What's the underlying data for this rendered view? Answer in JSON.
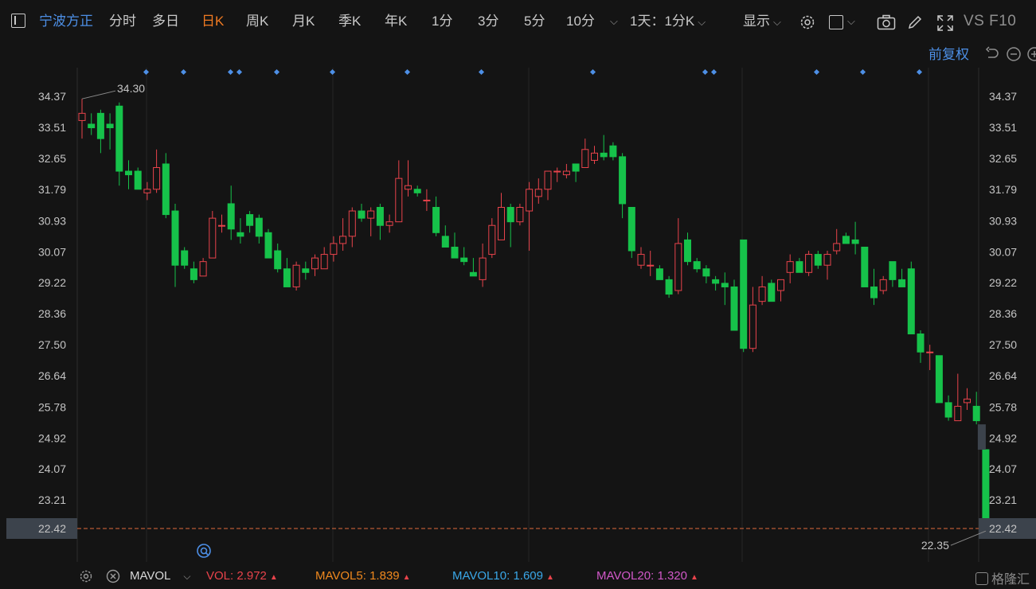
{
  "toolbar": {
    "stock_name": "宁波方正",
    "periods": [
      "分时",
      "多日",
      "日K",
      "周K",
      "月K",
      "季K",
      "年K",
      "1分",
      "3分",
      "5分",
      "10分"
    ],
    "active_period": "日K",
    "interval": "1天：1分K",
    "display": "显示",
    "vs_f10": "VS F10"
  },
  "adjust_label": "前复权",
  "price_axis": {
    "ticks": [
      "34.37",
      "33.51",
      "32.65",
      "31.79",
      "30.93",
      "30.07",
      "29.22",
      "28.36",
      "27.50",
      "26.64",
      "25.78",
      "24.92",
      "24.07",
      "23.21",
      "22.42"
    ],
    "current_price_label": "22.42"
  },
  "annotations": {
    "max_label": "34.30",
    "min_label": "22.35"
  },
  "colors": {
    "up": "#e8434b",
    "down": "#16c24a",
    "current_price_line": "#e06a3c",
    "event_marker": "#4d8fe6"
  },
  "volume_bar": {
    "indicator": "MAVOL",
    "vol_label": "VOL:",
    "vol_value": "2.972",
    "mavol5_label": "MAVOL5:",
    "mavol5_value": "1.839",
    "mavol10_label": "MAVOL10:",
    "mavol10_value": "1.609",
    "mavol20_label": "MAVOL20:",
    "mavol20_value": "1.320",
    "trend_marker": "▲"
  },
  "brand": "格隆汇",
  "chart_data": {
    "type": "candlestick",
    "title": "",
    "x": [
      "",
      "",
      "",
      "",
      "",
      "",
      "",
      "",
      "",
      "",
      "",
      "",
      "",
      "",
      "",
      "",
      "",
      "",
      "",
      "",
      "",
      "",
      "",
      "",
      "",
      "",
      "",
      "",
      "",
      "",
      "",
      "",
      "",
      "",
      "",
      "",
      "",
      "",
      "",
      "",
      "",
      "",
      "",
      "",
      "",
      "",
      "",
      "",
      "",
      "",
      "",
      "",
      "",
      "",
      "",
      "",
      "",
      "",
      "",
      "",
      "",
      "",
      "",
      "",
      "",
      "",
      "",
      "",
      "",
      "",
      "",
      "",
      "",
      "",
      "",
      "",
      "",
      "",
      "",
      "",
      "",
      "",
      "",
      "",
      "",
      "",
      "",
      "",
      "",
      "",
      "",
      "",
      "",
      "",
      "",
      "",
      "",
      "",
      ""
    ],
    "ohlc": [
      [
        33.7,
        34.3,
        33.2,
        33.9
      ],
      [
        33.6,
        33.9,
        33.3,
        33.5
      ],
      [
        33.9,
        34.0,
        32.8,
        33.2
      ],
      [
        33.6,
        33.9,
        32.9,
        33.5
      ],
      [
        34.1,
        34.2,
        31.9,
        32.3
      ],
      [
        32.3,
        32.6,
        31.8,
        32.2
      ],
      [
        32.3,
        32.4,
        31.8,
        31.8
      ],
      [
        31.7,
        32.0,
        31.5,
        31.8
      ],
      [
        31.8,
        32.9,
        31.7,
        32.4
      ],
      [
        32.5,
        32.8,
        31.0,
        31.1
      ],
      [
        31.2,
        31.4,
        29.1,
        29.7
      ],
      [
        30.1,
        30.2,
        29.6,
        29.7
      ],
      [
        29.6,
        29.8,
        29.2,
        29.3
      ],
      [
        29.4,
        29.9,
        29.4,
        29.8
      ],
      [
        29.9,
        31.2,
        29.9,
        31.0
      ],
      [
        30.8,
        31.1,
        30.6,
        30.8
      ],
      [
        31.4,
        31.9,
        30.4,
        30.7
      ],
      [
        30.6,
        31.0,
        30.3,
        30.5
      ],
      [
        31.1,
        31.2,
        30.6,
        30.8
      ],
      [
        31.0,
        31.1,
        30.3,
        30.5
      ],
      [
        30.6,
        30.7,
        29.9,
        29.9
      ],
      [
        30.1,
        30.3,
        29.5,
        29.6
      ],
      [
        29.6,
        29.9,
        29.1,
        29.1
      ],
      [
        29.1,
        29.8,
        29.0,
        29.7
      ],
      [
        29.6,
        29.8,
        29.3,
        29.5
      ],
      [
        29.6,
        30.0,
        29.4,
        29.9
      ],
      [
        29.6,
        30.2,
        29.6,
        30.0
      ],
      [
        30.0,
        30.5,
        29.8,
        30.3
      ],
      [
        30.3,
        31.0,
        30.1,
        30.5
      ],
      [
        30.5,
        31.3,
        30.2,
        31.2
      ],
      [
        31.2,
        31.4,
        30.9,
        31.0
      ],
      [
        31.0,
        31.3,
        30.5,
        31.2
      ],
      [
        31.3,
        31.4,
        30.4,
        30.8
      ],
      [
        30.8,
        31.1,
        30.6,
        30.9
      ],
      [
        30.9,
        32.6,
        30.9,
        32.1
      ],
      [
        31.8,
        32.6,
        31.6,
        31.9
      ],
      [
        31.8,
        31.9,
        31.6,
        31.7
      ],
      [
        31.5,
        31.8,
        31.2,
        31.5
      ],
      [
        31.3,
        31.6,
        30.5,
        30.6
      ],
      [
        30.5,
        30.8,
        30.2,
        30.2
      ],
      [
        30.2,
        30.6,
        29.9,
        29.9
      ],
      [
        29.9,
        30.2,
        29.7,
        29.8
      ],
      [
        29.5,
        29.9,
        29.4,
        29.4
      ],
      [
        29.3,
        30.3,
        29.1,
        29.9
      ],
      [
        30.0,
        31.0,
        29.9,
        30.8
      ],
      [
        30.4,
        31.7,
        30.4,
        31.3
      ],
      [
        31.3,
        31.4,
        30.2,
        30.9
      ],
      [
        30.9,
        31.4,
        30.8,
        31.3
      ],
      [
        31.2,
        32.0,
        30.1,
        31.8
      ],
      [
        31.6,
        32.1,
        31.4,
        31.8
      ],
      [
        31.8,
        32.3,
        31.5,
        32.3
      ],
      [
        32.3,
        32.4,
        32.0,
        32.3
      ],
      [
        32.2,
        32.5,
        32.1,
        32.3
      ],
      [
        32.5,
        32.5,
        32.0,
        32.3
      ],
      [
        32.4,
        33.2,
        32.4,
        32.9
      ],
      [
        32.6,
        33.0,
        32.5,
        32.8
      ],
      [
        32.8,
        33.3,
        32.6,
        32.7
      ],
      [
        33.0,
        33.1,
        32.6,
        32.7
      ],
      [
        32.7,
        32.8,
        31.0,
        31.4
      ],
      [
        31.3,
        31.3,
        29.9,
        30.1
      ],
      [
        29.7,
        30.2,
        29.6,
        30.0
      ],
      [
        29.7,
        30.1,
        29.4,
        29.7
      ],
      [
        29.6,
        29.7,
        29.3,
        29.3
      ],
      [
        29.3,
        29.4,
        28.8,
        28.9
      ],
      [
        29.0,
        31.0,
        28.9,
        30.3
      ],
      [
        30.4,
        30.6,
        29.7,
        29.8
      ],
      [
        29.8,
        29.9,
        29.5,
        29.6
      ],
      [
        29.6,
        29.7,
        29.2,
        29.4
      ],
      [
        29.3,
        29.4,
        29.0,
        29.2
      ],
      [
        29.2,
        29.5,
        28.6,
        29.1
      ],
      [
        29.1,
        29.3,
        27.9,
        27.9
      ],
      [
        30.4,
        30.4,
        27.3,
        27.4
      ],
      [
        27.4,
        29.1,
        27.3,
        28.6
      ],
      [
        28.7,
        29.4,
        28.6,
        29.1
      ],
      [
        29.2,
        29.3,
        28.7,
        28.7
      ],
      [
        29.0,
        29.3,
        28.7,
        29.3
      ],
      [
        29.5,
        30.0,
        29.2,
        29.8
      ],
      [
        29.8,
        29.9,
        29.5,
        29.5
      ],
      [
        29.5,
        30.1,
        29.4,
        30.0
      ],
      [
        30.0,
        30.1,
        29.6,
        29.7
      ],
      [
        29.7,
        30.1,
        29.3,
        30.0
      ],
      [
        30.1,
        30.7,
        30.0,
        30.3
      ],
      [
        30.5,
        30.6,
        30.3,
        30.3
      ],
      [
        30.4,
        30.9,
        30.0,
        30.3
      ],
      [
        30.2,
        30.2,
        29.1,
        29.1
      ],
      [
        29.1,
        29.6,
        28.6,
        28.8
      ],
      [
        29.0,
        29.4,
        28.9,
        29.3
      ],
      [
        29.8,
        29.8,
        29.1,
        29.3
      ],
      [
        29.3,
        29.6,
        29.1,
        29.1
      ],
      [
        29.6,
        29.8,
        27.8,
        27.8
      ],
      [
        27.8,
        27.9,
        27.0,
        27.3
      ],
      [
        27.3,
        27.5,
        26.8,
        27.3
      ],
      [
        27.2,
        27.2,
        25.9,
        25.9
      ],
      [
        25.9,
        26.1,
        25.4,
        25.5
      ],
      [
        25.4,
        26.7,
        25.4,
        25.8
      ],
      [
        25.9,
        26.3,
        25.7,
        26.0
      ],
      [
        25.8,
        26.2,
        25.3,
        25.4
      ],
      [
        24.6,
        24.6,
        22.35,
        22.42
      ]
    ],
    "ylim": [
      22.3,
      34.45
    ],
    "y_ticks": [
      34.37,
      33.51,
      32.65,
      31.79,
      30.93,
      30.07,
      29.22,
      28.36,
      27.5,
      26.64,
      25.78,
      24.92,
      24.07,
      23.21,
      22.42
    ],
    "last_price": 22.42,
    "max_annotation": 34.3,
    "min_annotation": 22.35,
    "xlabel": "",
    "ylabel": "",
    "grid": true
  }
}
